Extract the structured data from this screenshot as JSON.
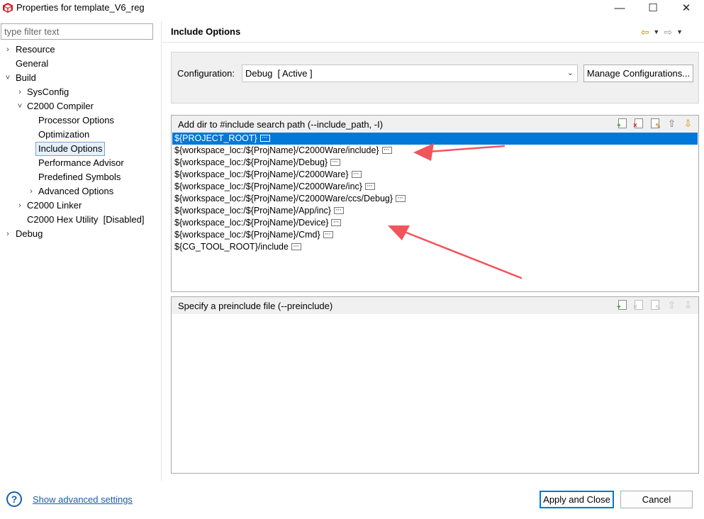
{
  "window": {
    "title": "Properties for template_V6_reg",
    "minimize": "—",
    "maximize": "☐",
    "close": "✕"
  },
  "filter": {
    "placeholder": "type filter text"
  },
  "tree": [
    {
      "label": "Resource",
      "twisty": "›"
    },
    {
      "label": "General",
      "twisty": ""
    },
    {
      "label": "Build",
      "twisty": "˅"
    },
    {
      "label": "SysConfig",
      "twisty": "›"
    },
    {
      "label": "C2000 Compiler",
      "twisty": "˅"
    },
    {
      "label": "Processor Options",
      "twisty": ""
    },
    {
      "label": "Optimization",
      "twisty": ""
    },
    {
      "label": "Include Options",
      "twisty": "",
      "selected": true
    },
    {
      "label": "Performance Advisor",
      "twisty": ""
    },
    {
      "label": "Predefined Symbols",
      "twisty": ""
    },
    {
      "label": "Advanced Options",
      "twisty": "›"
    },
    {
      "label": "C2000 Linker",
      "twisty": "›"
    },
    {
      "label": "C2000 Hex Utility  [Disabled]",
      "twisty": ""
    },
    {
      "label": "Debug",
      "twisty": "›"
    }
  ],
  "page": {
    "title": "Include Options",
    "nav_back": "⇦",
    "nav_forward": "⇨",
    "nav_caret": "▼"
  },
  "configuration": {
    "label": "Configuration:",
    "value": "Debug  [ Active ]",
    "manage_button": "Manage Configurations..."
  },
  "include_paths": {
    "title": "Add dir to #include search path (--include_path, -I)",
    "items": [
      "${PROJECT_ROOT}",
      "${workspace_loc:/${ProjName}/C2000Ware/include}",
      "${workspace_loc:/${ProjName}/Debug}",
      "${workspace_loc:/${ProjName}/C2000Ware}",
      "${workspace_loc:/${ProjName}/C2000Ware/inc}",
      "${workspace_loc:/${ProjName}/C2000Ware/ccs/Debug}",
      "${workspace_loc:/${ProjName}/App/inc}",
      "${workspace_loc:/${ProjName}/Device}",
      "${workspace_loc:/${ProjName}/Cmd}",
      "${CG_TOOL_ROOT}/include"
    ],
    "selected_index": 0
  },
  "preinclude": {
    "title": "Specify a preinclude file (--preinclude)",
    "items": []
  },
  "tool_icons": {
    "add": "+",
    "delete": "×",
    "edit": "✎",
    "move_up": "⇧",
    "move_down": "⇩"
  },
  "bottom": {
    "help": "?",
    "advanced_link": "Show advanced settings",
    "apply_close": "Apply and Close",
    "cancel": "Cancel"
  },
  "colors": {
    "selection": "#0078d7",
    "annotation_arrow": "#f2545b",
    "link": "#1a5ea8"
  }
}
